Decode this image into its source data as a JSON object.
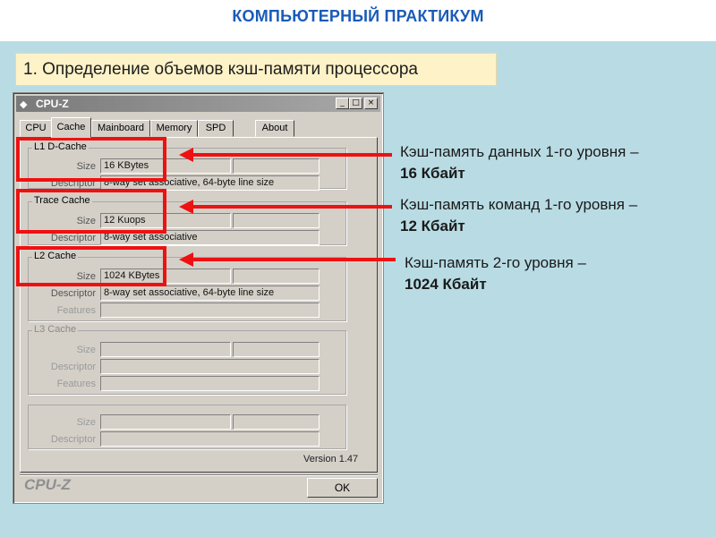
{
  "slide": {
    "title": "КОМПЬЮТЕРНЫЙ ПРАКТИКУМ",
    "subtitle": "1. Определение объемов кэш-памяти процессора"
  },
  "window": {
    "title": "CPU-Z",
    "title_icon": "cpu-z-icon",
    "minimize_glyph": "_",
    "maximize_glyph": "□",
    "close_glyph": "×",
    "tabs": [
      "CPU",
      "Cache",
      "Mainboard",
      "Memory",
      "SPD",
      "About"
    ],
    "active_tab": "Cache",
    "groups": {
      "l1": {
        "label": "L1 D-Cache",
        "size_label": "Size",
        "size_value": "16 KBytes",
        "descriptor_label": "Descriptor",
        "descriptor_value": "8-way set associative, 64-byte line size"
      },
      "trace": {
        "label": "Trace Cache",
        "size_label": "Size",
        "size_value": "12 Kuops",
        "descriptor_label": "Descriptor",
        "descriptor_value": "8-way set associative"
      },
      "l2": {
        "label": "L2 Cache",
        "size_label": "Size",
        "size_value": "1024 KBytes",
        "descriptor_label": "Descriptor",
        "descriptor_value": "8-way set associative, 64-byte line size",
        "features_label": "Features",
        "features_value": ""
      },
      "l3": {
        "label": "L3 Cache",
        "size_label": "Size",
        "descriptor_label": "Descriptor",
        "features_label": "Features"
      },
      "extra": {
        "size_label": "Size",
        "descriptor_label": "Descriptor"
      }
    },
    "version": "Version 1.47",
    "brand": "CPU-Z",
    "ok_label": "OK"
  },
  "annotations": {
    "note1_line1": "Кэш-память данных 1-го уровня –",
    "note1_line2": "16 Кбайт",
    "note2_line1": "Кэш-память команд 1-го уровня –",
    "note2_line2": "12 Кбайт",
    "note3_line1": "Кэш-память 2-го уровня –",
    "note3_line2": "1024 Кбайт",
    "color": "#ee1111"
  },
  "colors": {
    "title": "#1a5bb8",
    "background": "#b9dce4",
    "subtitle_bg": "#fdf2c8",
    "window": "#d4d0c8"
  }
}
